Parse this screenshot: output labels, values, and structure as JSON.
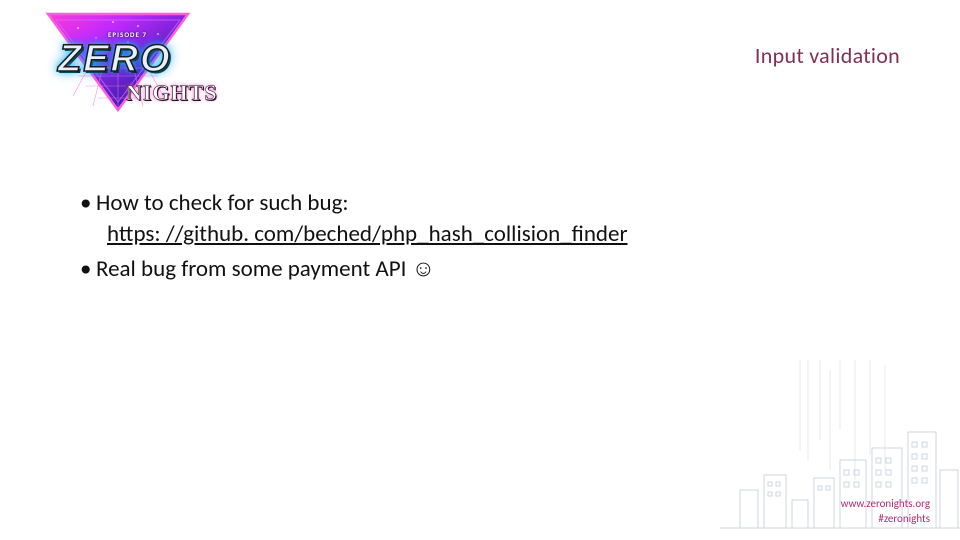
{
  "logo": {
    "episode": "EPISODE 7",
    "main": "ZERO",
    "sub": "NIGHTS"
  },
  "title": "Input validation",
  "bullets": [
    {
      "text": "How to check for such bug:",
      "link": "https: //github. com/beched/php_hash_collision_finder"
    },
    {
      "text": "Real bug from some payment API ☺",
      "link": null
    }
  ],
  "footer": {
    "url": "www.zeronights.org",
    "hashtag": "#zeronights"
  }
}
